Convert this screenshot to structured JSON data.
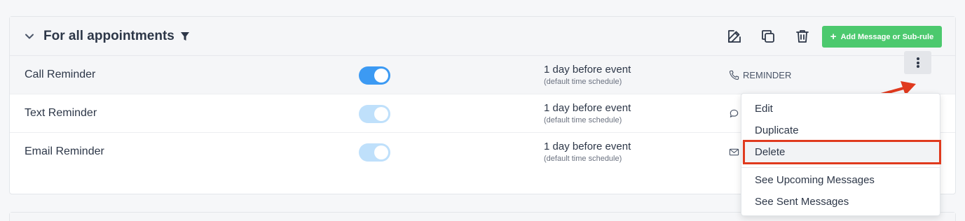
{
  "group": {
    "title": "For all appointments",
    "add_button_label": "Add Message or Sub-rule"
  },
  "rows": [
    {
      "name": "Call Reminder",
      "enabled": true,
      "schedule": "1 day before event",
      "schedule_note": "(default time schedule)",
      "type_label": "REMINDER",
      "type_icon": "phone-icon"
    },
    {
      "name": "Text Reminder",
      "enabled": true,
      "schedule": "1 day before event",
      "schedule_note": "(default time schedule)",
      "type_label": "",
      "type_icon": "chat-bubble-icon"
    },
    {
      "name": "Email Reminder",
      "enabled": true,
      "schedule": "1 day before event",
      "schedule_note": "(default time schedule)",
      "type_label": "",
      "type_icon": "envelope-icon"
    }
  ],
  "context_menu": {
    "items": [
      "Edit",
      "Duplicate",
      "Delete",
      "See Upcoming Messages",
      "See Sent Messages"
    ],
    "highlighted": "Delete"
  },
  "colors": {
    "accent_green": "#4cc96e",
    "toggle_on": "#3c9af3",
    "annotation_red": "#e03a1e"
  }
}
